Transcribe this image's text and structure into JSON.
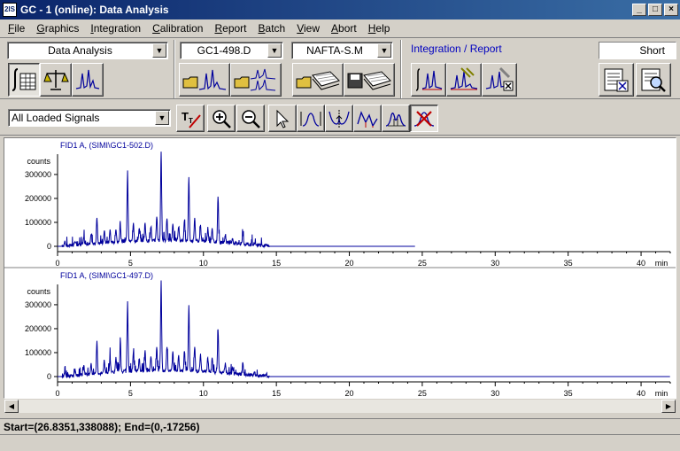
{
  "window": {
    "title": "GC - 1 (online): Data Analysis",
    "icon_text": "2IS"
  },
  "menu": [
    {
      "label": "File",
      "u": "F",
      "rest": "ile"
    },
    {
      "label": "Graphics",
      "u": "G",
      "rest": "raphics"
    },
    {
      "label": "Integration",
      "u": "I",
      "rest": "ntegration"
    },
    {
      "label": "Calibration",
      "u": "C",
      "rest": "alibration"
    },
    {
      "label": "Report",
      "u": "R",
      "rest": "eport"
    },
    {
      "label": "Batch",
      "u": "B",
      "rest": "atch"
    },
    {
      "label": "View",
      "u": "V",
      "rest": "iew"
    },
    {
      "label": "Abort",
      "u": "A",
      "rest": "bort"
    },
    {
      "label": "Help",
      "u": "H",
      "rest": "elp"
    }
  ],
  "toolbar": {
    "view_combo": "Data Analysis",
    "file_combo": "GC1-498.D",
    "method_combo": "NAFTA-S.M",
    "integration_group_label": "Integration / Report",
    "report_style": "Short",
    "signals_combo": "All Loaded Signals"
  },
  "colors": {
    "signal": "#00009c",
    "title_grad_start": "#0a246a",
    "title_grad_end": "#3a6ea5",
    "group_label": "#0000c0"
  },
  "status": {
    "text": "Start=(26.8351,338088); End=(0,-17256)"
  },
  "chart_data": [
    {
      "type": "line",
      "title": "FID1 A,  (SIMI\\GC1-502.D)",
      "ylabel": "counts",
      "xunit": "min",
      "xlim": [
        0,
        42
      ],
      "ylim": [
        -10000,
        370000
      ],
      "xticks": [
        0,
        5,
        10,
        15,
        20,
        25,
        30,
        35,
        40
      ],
      "yticks": [
        0,
        100000,
        200000,
        300000
      ],
      "ytick_labels": [
        "0",
        "100000",
        "200000",
        "300000"
      ],
      "signal_end": 24.5,
      "peaks": [
        [
          0.5,
          25000
        ],
        [
          1.2,
          20000
        ],
        [
          1.8,
          30000
        ],
        [
          2.3,
          45000
        ],
        [
          2.7,
          110000
        ],
        [
          3.2,
          50000
        ],
        [
          3.6,
          60000
        ],
        [
          4.0,
          55000
        ],
        [
          4.3,
          70000
        ],
        [
          4.8,
          290000
        ],
        [
          5.2,
          80000
        ],
        [
          5.6,
          50000
        ],
        [
          6.0,
          75000
        ],
        [
          6.4,
          60000
        ],
        [
          6.8,
          100000
        ],
        [
          7.1,
          375000
        ],
        [
          7.5,
          95000
        ],
        [
          7.9,
          70000
        ],
        [
          8.3,
          60000
        ],
        [
          8.7,
          80000
        ],
        [
          9.0,
          270000
        ],
        [
          9.4,
          100000
        ],
        [
          9.8,
          65000
        ],
        [
          10.3,
          55000
        ],
        [
          10.6,
          60000
        ],
        [
          11.0,
          185000
        ],
        [
          11.5,
          35000
        ],
        [
          12.0,
          20000
        ],
        [
          12.7,
          45000
        ],
        [
          13.5,
          10000
        ],
        [
          14.3,
          8000
        ]
      ]
    },
    {
      "type": "line",
      "title": "FID1 A,  (SIMI\\GC1-497.D)",
      "ylabel": "counts",
      "xunit": "min",
      "xlim": [
        0,
        42
      ],
      "ylim": [
        -10000,
        370000
      ],
      "xticks": [
        0,
        5,
        10,
        15,
        20,
        25,
        30,
        35,
        40
      ],
      "yticks": [
        0,
        100000,
        200000,
        300000
      ],
      "ytick_labels": [
        "0",
        "100000",
        "200000",
        "300000"
      ],
      "signal_end": 42,
      "peaks": [
        [
          0.5,
          20000
        ],
        [
          1.2,
          25000
        ],
        [
          1.8,
          35000
        ],
        [
          2.3,
          40000
        ],
        [
          2.7,
          140000
        ],
        [
          3.2,
          55000
        ],
        [
          3.6,
          65000
        ],
        [
          4.0,
          60000
        ],
        [
          4.3,
          110000
        ],
        [
          4.8,
          290000
        ],
        [
          5.2,
          85000
        ],
        [
          5.6,
          55000
        ],
        [
          6.0,
          80000
        ],
        [
          6.4,
          65000
        ],
        [
          6.8,
          95000
        ],
        [
          7.1,
          375000
        ],
        [
          7.5,
          100000
        ],
        [
          7.9,
          75000
        ],
        [
          8.3,
          65000
        ],
        [
          8.7,
          85000
        ],
        [
          9.0,
          275000
        ],
        [
          9.4,
          105000
        ],
        [
          9.8,
          70000
        ],
        [
          10.3,
          60000
        ],
        [
          10.6,
          65000
        ],
        [
          11.0,
          185000
        ],
        [
          11.5,
          40000
        ],
        [
          12.0,
          25000
        ],
        [
          12.7,
          50000
        ],
        [
          13.5,
          12000
        ],
        [
          14.3,
          10000
        ]
      ]
    }
  ]
}
